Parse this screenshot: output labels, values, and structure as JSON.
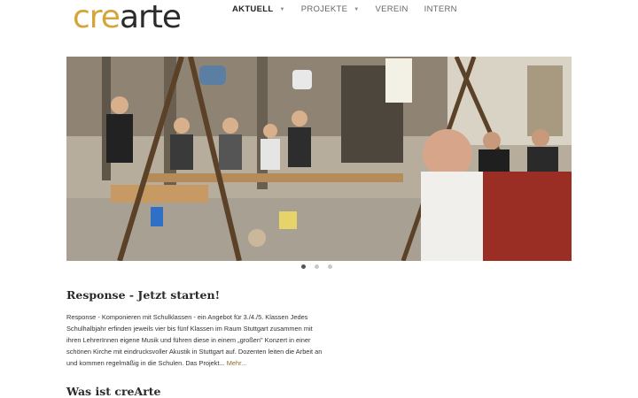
{
  "brand": {
    "logo_part1": "cre",
    "logo_part2": "arte"
  },
  "nav": {
    "items": [
      {
        "label": "AKTUELL",
        "dropdown": true,
        "active": true
      },
      {
        "label": "PROJEKTE",
        "dropdown": true,
        "active": false
      },
      {
        "label": "VEREIN",
        "dropdown": false,
        "active": false
      },
      {
        "label": "INTERN",
        "dropdown": false,
        "active": false
      }
    ]
  },
  "slider": {
    "slide_count": 3,
    "active_index": 0
  },
  "article": {
    "title": "Response - Jetzt starten!",
    "text": "Response - Komponieren mit Schulklassen - ein Angebot für 3./4./5. Klassen Jedes Schulhalbjahr erfinden jeweils vier bis fünf Klassen im Raum Stuttgart zusammen mit ihren LehrerInnen eigene Musik und führen diese in einem „großen\" Konzert in einer schönen Kirche mit eindrucksvoller Akustik in Stuttgart auf. Dozenten leiten die Arbeit an und kommen regelmäßig in die Schulen. Das Projekt...",
    "more_label": "Mehr..."
  },
  "section2": {
    "title": "Was ist creArte"
  },
  "colors": {
    "brand_gold": "#d4a53a",
    "brand_dark": "#2b2b2b",
    "link": "#8a6d2b"
  }
}
